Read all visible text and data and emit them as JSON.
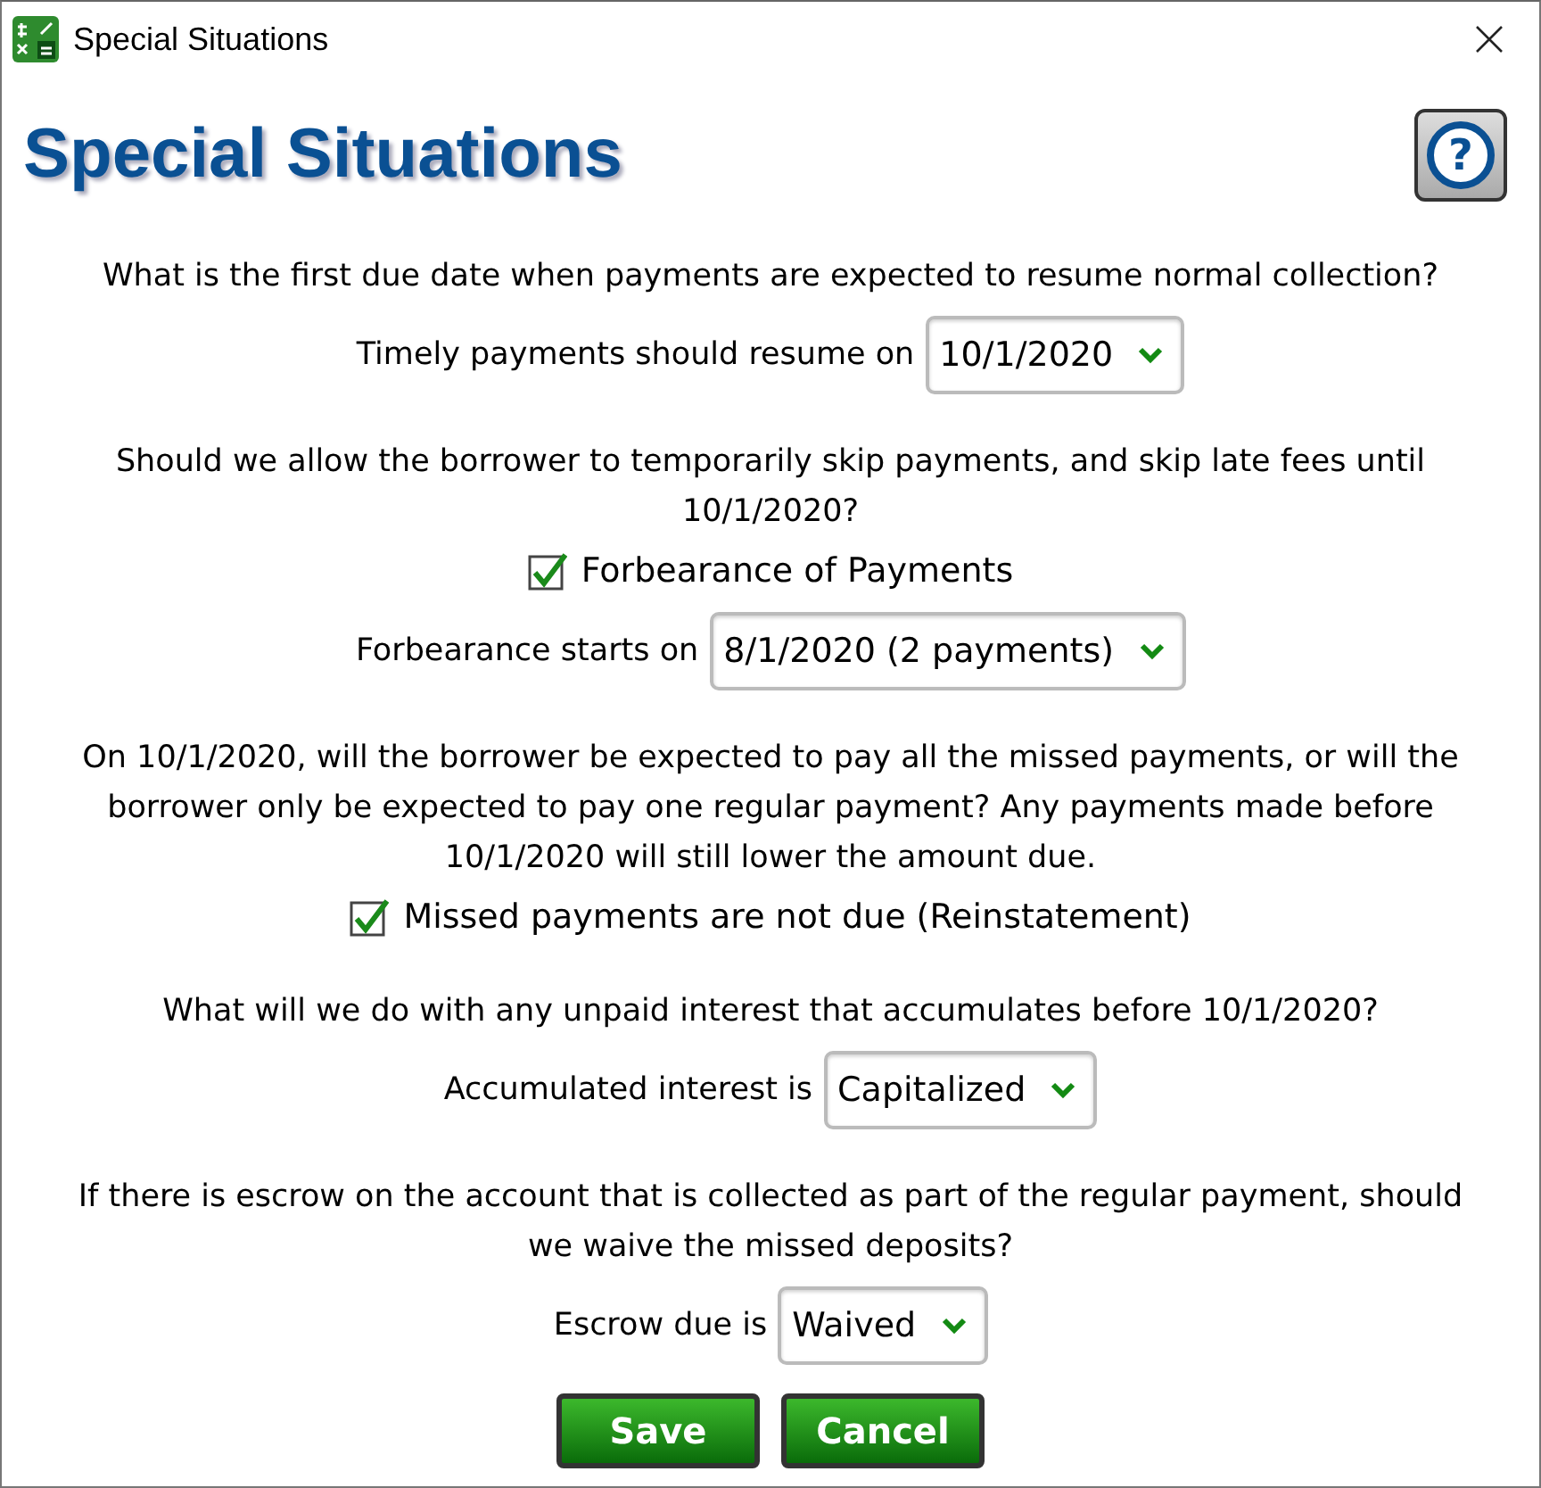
{
  "window": {
    "title": "Special Situations"
  },
  "heading": "Special Situations",
  "help": {
    "glyph": "?"
  },
  "items": [
    {
      "kind": "question",
      "text": "What is the first due date when payments are expected to resume normal collection?"
    },
    {
      "kind": "dropdown",
      "label": "Timely payments should resume on",
      "value": "10/1/2020"
    },
    {
      "kind": "question",
      "text": "Should we allow the borrower to temporarily skip payments, and skip late fees until 10/1/2020?"
    },
    {
      "kind": "checkbox",
      "label": "Forbearance of Payments",
      "checked": true
    },
    {
      "kind": "dropdown",
      "label": "Forbearance starts on",
      "value": "8/1/2020 (2 payments)"
    },
    {
      "kind": "question",
      "text": "On 10/1/2020, will the borrower be expected to pay all the missed payments, or will the borrower only be expected to pay one regular payment? Any payments made before 10/1/2020 will still lower the amount due."
    },
    {
      "kind": "checkbox",
      "label": "Missed payments are not due (Reinstatement)",
      "checked": true
    },
    {
      "kind": "question",
      "text": "What will we do with any unpaid interest that accumulates before 10/1/2020?"
    },
    {
      "kind": "dropdown",
      "label": "Accumulated interest is",
      "value": "Capitalized"
    },
    {
      "kind": "question",
      "text": "If there is escrow on the account that is collected as part of the regular payment, should we waive the missed deposits?"
    },
    {
      "kind": "dropdown",
      "label": "Escrow due is",
      "value": "Waived"
    }
  ],
  "buttons": [
    "Save",
    "Cancel"
  ]
}
